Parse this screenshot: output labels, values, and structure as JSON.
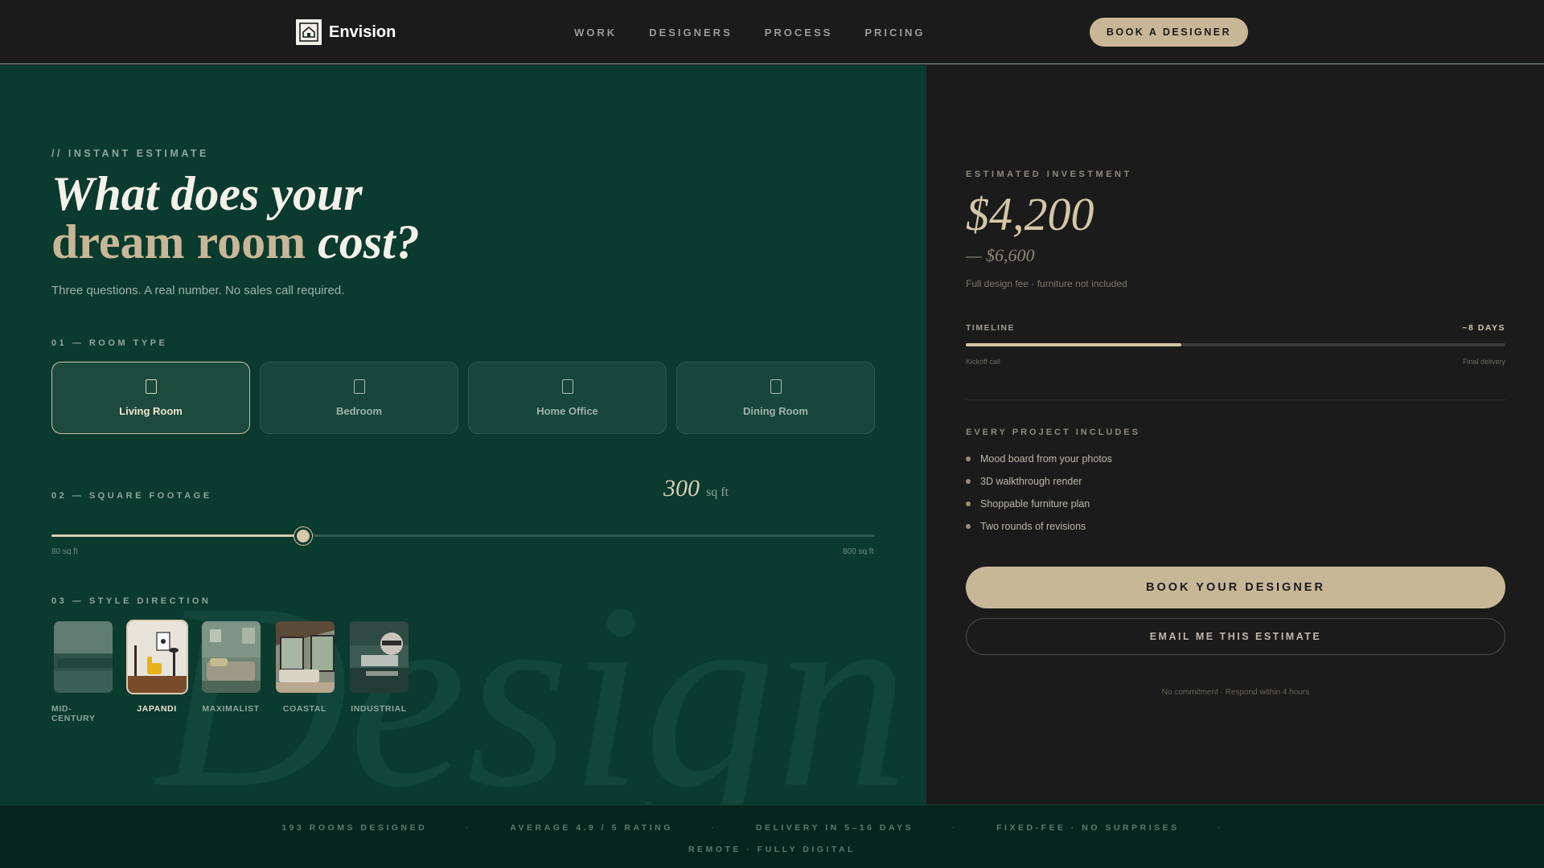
{
  "nav": {
    "brand": "Envision",
    "links": [
      "WORK",
      "DESIGNERS",
      "PROCESS",
      "PRICING"
    ],
    "cta": "BOOK A DESIGNER"
  },
  "estimator": {
    "eyebrow": "// INSTANT ESTIMATE",
    "headline_line1": "What does your",
    "headline_line2a": "dream room",
    "headline_line2b": "cost?",
    "subhead": "Three questions. A real number. No sales call required.",
    "watermark": "Design",
    "room_type": {
      "label": "01 — ROOM TYPE",
      "options": [
        {
          "name": "Living Room",
          "selected": true
        },
        {
          "name": "Bedroom",
          "selected": false
        },
        {
          "name": "Home Office",
          "selected": false
        },
        {
          "name": "Dining Room",
          "selected": false
        }
      ]
    },
    "square_footage": {
      "label": "02 — SQUARE FOOTAGE",
      "value": "300",
      "unit": "sq ft",
      "min_label": "80 sq ft",
      "max_label": "800 sq ft",
      "min": 80,
      "max": 800,
      "current": 300
    },
    "style": {
      "label": "03 — STYLE DIRECTION",
      "options": [
        {
          "name": "MID-CENTURY",
          "selected": false
        },
        {
          "name": "JAPANDI",
          "selected": true
        },
        {
          "name": "MAXIMALIST",
          "selected": false
        },
        {
          "name": "COASTAL",
          "selected": false
        },
        {
          "name": "INDUSTRIAL",
          "selected": false
        }
      ]
    }
  },
  "summary": {
    "eyebrow": "ESTIMATED INVESTMENT",
    "price_low": "$4,200",
    "price_high": "— $6,600",
    "price_note": "Full design fee · furniture not included",
    "timeline_label": "TIMELINE",
    "timeline_days": "~8 DAYS",
    "timeline_progress": 0.4,
    "timeline_start": "Kickoff call",
    "timeline_end": "Final delivery",
    "includes_eyebrow": "EVERY PROJECT INCLUDES",
    "includes": [
      "Mood board from your photos",
      "3D walkthrough render",
      "Shoppable furniture plan",
      "Two rounds of revisions"
    ],
    "primary_cta": "BOOK YOUR DESIGNER",
    "secondary_cta": "EMAIL ME THIS ESTIMATE",
    "fine_print": "No commitment · Respond within 4 hours"
  },
  "footer": {
    "stats_row1": [
      "193 ROOMS DESIGNED",
      "AVERAGE 4.9 / 5 RATING",
      "DELIVERY IN 5–16 DAYS",
      "FIXED-FEE · NO SURPRISES"
    ],
    "stats_row2": "REMOTE · FULLY DIGITAL"
  },
  "colors": {
    "accent": "#c8b797",
    "forest": "#0b3a2e",
    "charcoal": "#1b1b1b"
  }
}
